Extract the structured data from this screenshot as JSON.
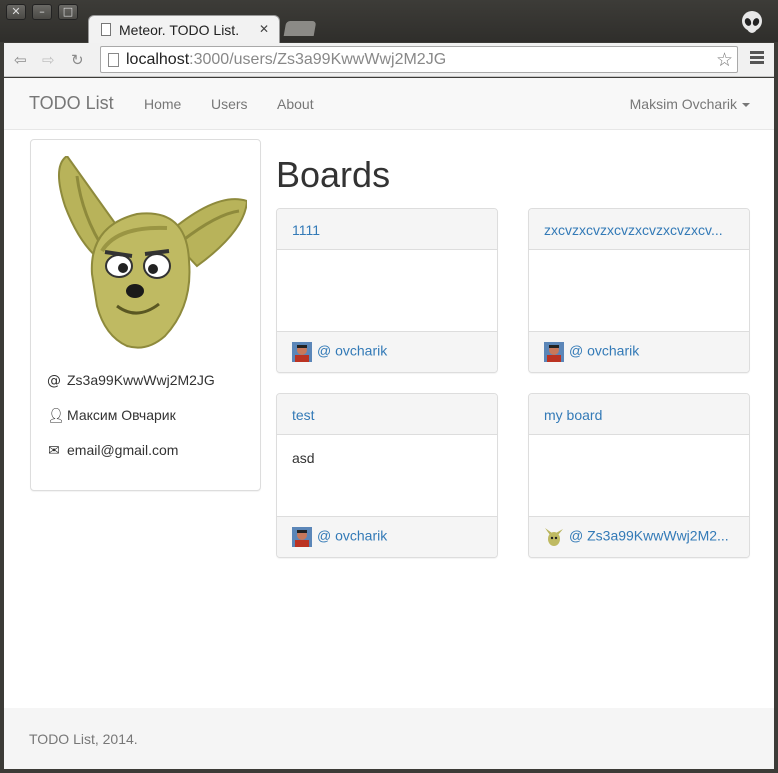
{
  "browser": {
    "tab_title": "Meteor. TODO List.",
    "url_host": "localhost",
    "url_rest": ":3000/users/Zs3a99KwwWwj2M2JG"
  },
  "navbar": {
    "brand": "TODO List",
    "links": [
      "Home",
      "Users",
      "About"
    ],
    "user": "Maksim Ovcharik"
  },
  "profile": {
    "username": "Zs3a99KwwWwj2M2JG",
    "fullname": "Максим Овчарик",
    "email": "email@gmail.com"
  },
  "boards_heading": "Boards",
  "boards": [
    {
      "title": "1111",
      "body": "",
      "owner": "@ ovcharik"
    },
    {
      "title": "zxcvzxcvzxcvzxcvzxcvzxcv...",
      "body": "",
      "owner": "@ ovcharik"
    },
    {
      "title": "test",
      "body": "asd",
      "owner": "@ ovcharik"
    },
    {
      "title": "my board",
      "body": "",
      "owner": "@ Zs3a99KwwWwj2M2..."
    }
  ],
  "footer": "TODO List, 2014.",
  "colors": {
    "link": "#337ab7",
    "navbar_bg": "#f8f8f8",
    "panel_bg": "#f5f5f5"
  }
}
